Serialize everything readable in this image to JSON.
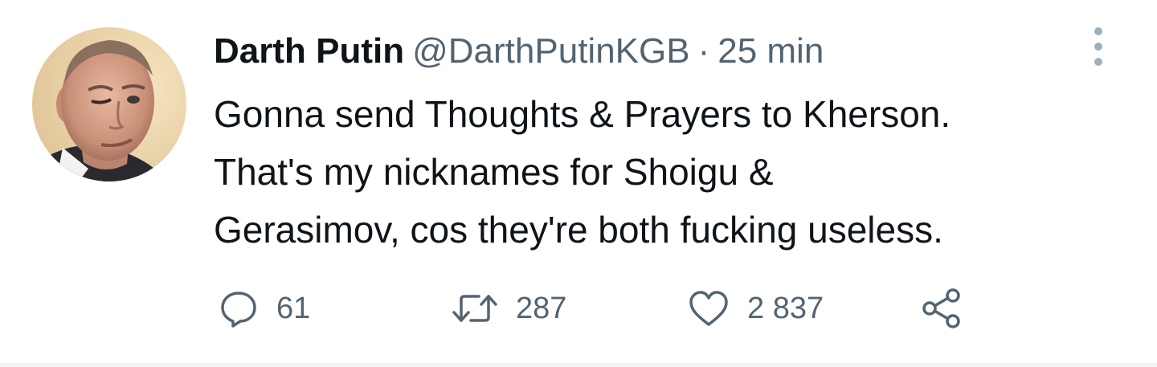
{
  "tweet": {
    "author": {
      "name": "Darth Putin",
      "handle": "@DarthPutinKGB",
      "separator": "·",
      "time": "25 min"
    },
    "text_lines": [
      "Gonna send Thoughts & Prayers to Kherson.",
      "That's my nicknames for Shoigu &",
      "Gerasimov, cos they're both fucking useless."
    ],
    "actions": {
      "reply": {
        "icon": "reply-icon",
        "count": "61"
      },
      "retweet": {
        "icon": "retweet-icon",
        "count": "287"
      },
      "like": {
        "icon": "heart-icon",
        "count": "2 837"
      },
      "share": {
        "icon": "share-icon"
      }
    },
    "colors": {
      "text_primary": "#0f1419",
      "text_secondary": "#536471",
      "more_dots": "#9fb0bd",
      "divider": "#eff3f4"
    }
  }
}
